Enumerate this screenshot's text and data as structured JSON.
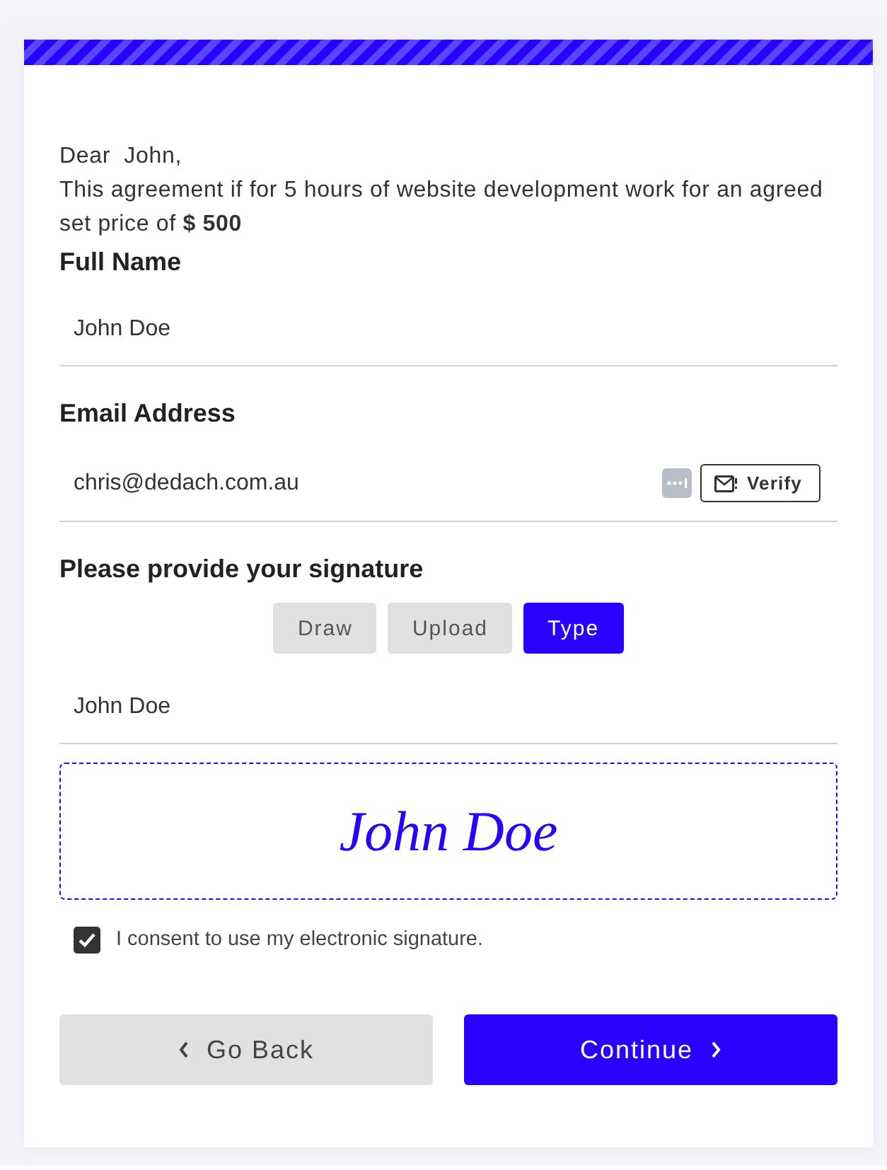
{
  "letter": {
    "greeting": "Dear  John,",
    "body": "This agreement if for 5 hours of website development work for an agreed set price of **$ 500**"
  },
  "fields": [
    {
      "label": "Full Name",
      "value": "John Doe"
    },
    {
      "label": "Email Address",
      "value": "chris@dedach.com.au",
      "action": "Verify"
    }
  ],
  "signature": {
    "label": "Please provide your signature",
    "tabs": [
      {
        "label": "Draw",
        "selected": false
      },
      {
        "label": "Upload",
        "selected": false
      },
      {
        "label": "Type",
        "selected": true
      }
    ],
    "typed_value": "John Doe",
    "preview": "John Doe"
  },
  "consent": {
    "label": "I consent to use my electronic signature.",
    "checked": true
  },
  "buttons": [
    {
      "label": "Go Back",
      "kind": "back"
    },
    {
      "label": "Continue",
      "kind": "continue"
    }
  ]
}
